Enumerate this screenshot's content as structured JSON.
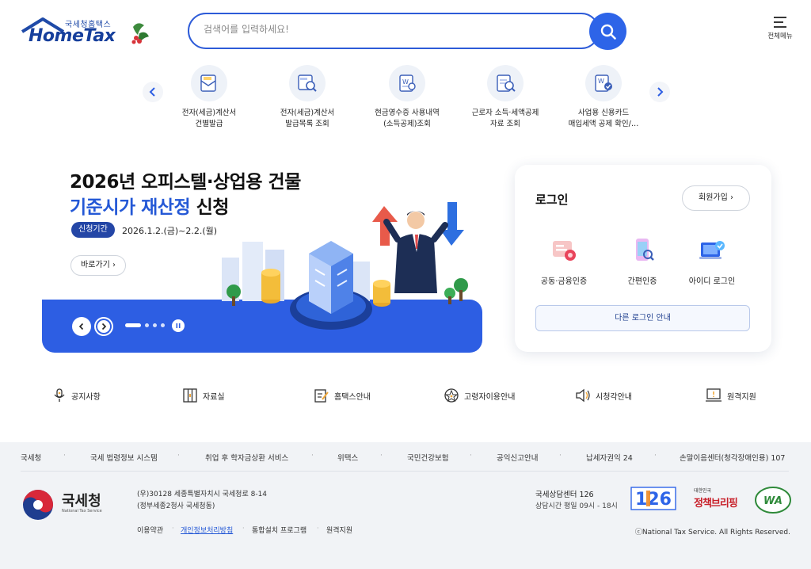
{
  "header": {
    "logo_small": "국세청홈택스",
    "logo_big": "HomeTax",
    "search_placeholder": "검색어를 입력하세요!",
    "menu_label": "전체메뉴"
  },
  "quick_menu": [
    {
      "line1": "전자(세금)계산서",
      "line2": "건별발급",
      "icon": "tax-invoice-icon"
    },
    {
      "line1": "전자(세금)계산서",
      "line2": "발급목록 조회",
      "icon": "invoice-search-icon"
    },
    {
      "line1": "현금영수증 사용내역",
      "line2": "(소득공제)조회",
      "icon": "receipt-icon"
    },
    {
      "line1": "근로자 소득·세액공제",
      "line2": "자료 조회",
      "icon": "deduction-icon"
    },
    {
      "line1": "사업용 신용카드",
      "line2": "매입세액 공제 확인/…",
      "icon": "credit-card-doc-icon"
    }
  ],
  "banner": {
    "title_line1": "2026년 오피스텔·상업용 건물",
    "title_line2_highlight": "기준시가 재산정",
    "title_line2_rest": " 신청",
    "period_badge": "신청기간",
    "period_text": "2026.1.2.(금)~2.2.(월)",
    "go_button": "바로가기"
  },
  "login": {
    "title": "로그인",
    "join_button": "회원가입",
    "options": [
      {
        "label": "공동·금융인증",
        "icon": "certificate-icon"
      },
      {
        "label": "간편인증",
        "icon": "simple-auth-icon"
      },
      {
        "label": "아이디 로그인",
        "icon": "id-login-icon"
      }
    ],
    "other_login": "다른 로그인 안내"
  },
  "shortcuts": [
    {
      "label": "공지사항",
      "icon": "microphone-icon"
    },
    {
      "label": "자료실",
      "icon": "archive-icon"
    },
    {
      "label": "홈택스안내",
      "icon": "guide-icon"
    },
    {
      "label": "고령자이용안내",
      "icon": "senior-icon"
    },
    {
      "label": "시청각안내",
      "icon": "speaker-icon"
    },
    {
      "label": "원격지원",
      "icon": "remote-support-icon"
    }
  ],
  "footer": {
    "links": [
      "국세청",
      "국세 법령정보 시스템",
      "취업 후 학자금상환 서비스",
      "위택스",
      "국민건강보험",
      "공익신고안내",
      "납세자권익 24",
      "손말이음센터(청각장애인용) 107"
    ],
    "org_name": "국세청",
    "org_english": "National Tax Service",
    "address1": "(우)30128 세종특별자치시 국세청로 8-14",
    "address2": "(정부세종2청사 국세청동)",
    "bottom_links": [
      "이용약관",
      "개인정보처리방침",
      "통합설치 프로그램",
      "원격지원"
    ],
    "center_name": "국세상담센터 126",
    "center_hours": "상담시간 평일 09시 - 18시",
    "copyright": "ⓒNational Tax Service. All Rights Reserved.",
    "badge_126": "126",
    "policy_small": "대한민국",
    "policy_big": "정책브리핑",
    "wa_mark": "WA"
  },
  "colors": {
    "brand_blue": "#2d5ee3",
    "navy": "#163f9c",
    "accent_red": "#e04a4a"
  }
}
